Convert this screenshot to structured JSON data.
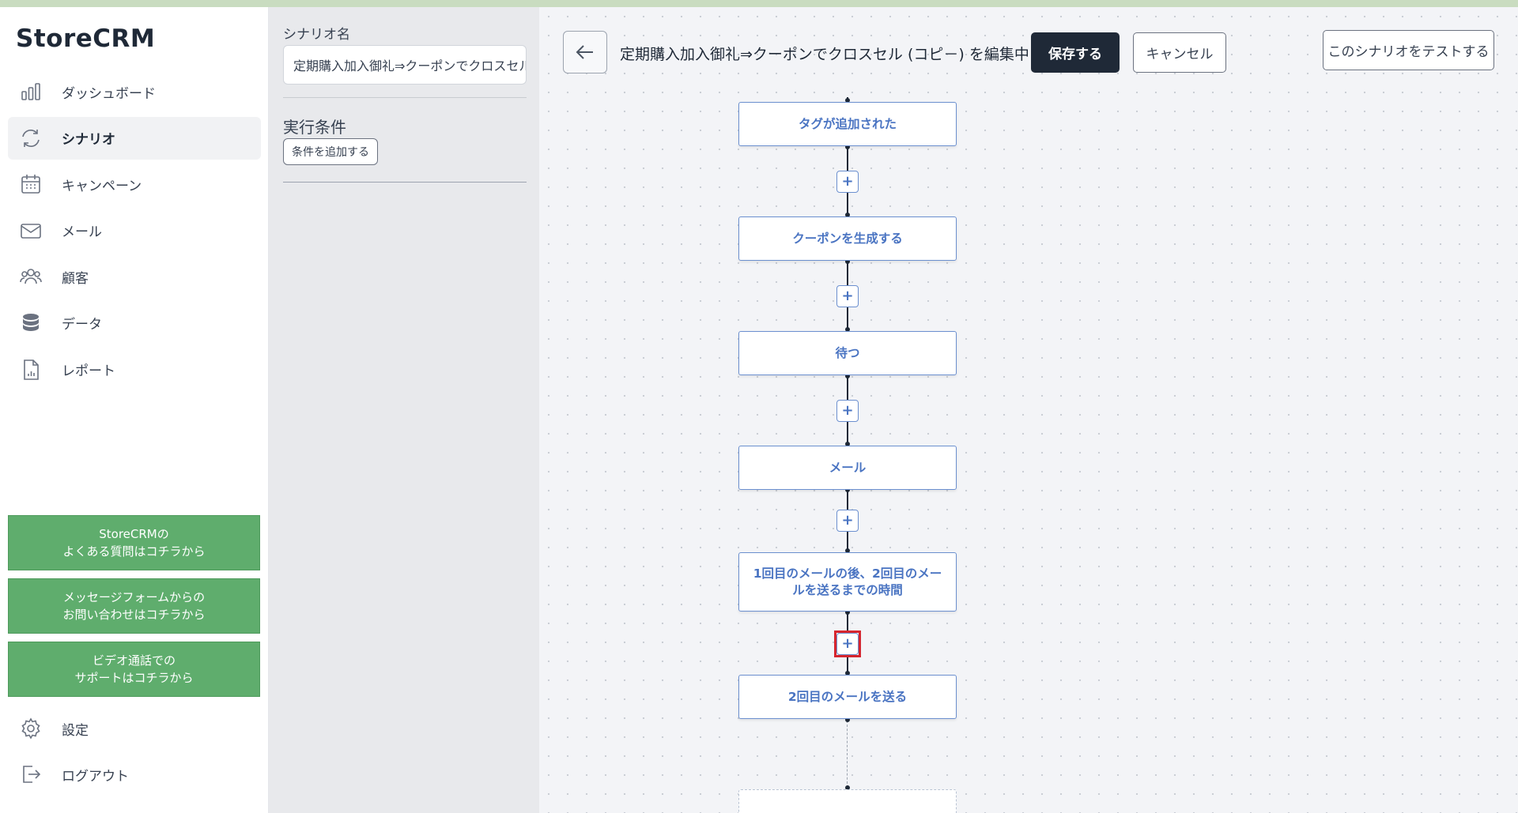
{
  "app": {
    "logo": "StoreCRM"
  },
  "sidebar": {
    "items": [
      {
        "label": "ダッシュボード",
        "icon": "bar-chart-icon"
      },
      {
        "label": "シナリオ",
        "icon": "refresh-icon",
        "active": true
      },
      {
        "label": "キャンペーン",
        "icon": "calendar-icon"
      },
      {
        "label": "メール",
        "icon": "mail-icon"
      },
      {
        "label": "顧客",
        "icon": "users-icon"
      },
      {
        "label": "データ",
        "icon": "database-icon"
      },
      {
        "label": "レポート",
        "icon": "report-icon"
      }
    ],
    "help_buttons": [
      {
        "line1": "StoreCRMの",
        "line2": "よくある質問はコチラから"
      },
      {
        "line1": "メッセージフォームからの",
        "line2": "お問い合わせはコチラから"
      },
      {
        "line1": "ビデオ通話での",
        "line2": "サポートはコチラから"
      }
    ],
    "bottom_items": [
      {
        "label": "設定",
        "icon": "gear-icon"
      },
      {
        "label": "ログアウト",
        "icon": "logout-icon"
      }
    ],
    "help_color": "#5fad6d"
  },
  "panel": {
    "name_label": "シナリオ名",
    "name_value": "定期購入加入御礼⇒クーポンでクロスセル (コピー)",
    "conditions_label": "実行条件",
    "add_condition_button": "条件を追加する"
  },
  "header": {
    "title": "定期購入加入御礼⇒クーポンでクロスセル (コピ－) を編集中",
    "save_button": "保存する",
    "cancel_button": "キャンセル",
    "test_button": "このシナリオをテストする"
  },
  "flow": {
    "nodes": [
      {
        "label": "タグが追加された"
      },
      {
        "label": "クーポンを生成する"
      },
      {
        "label": "待つ"
      },
      {
        "label": "メール"
      },
      {
        "label": "1回目のメールの後、2回目のメールを送るまでの時間"
      },
      {
        "label": "2回目のメールを送る"
      }
    ],
    "add_step_symbol": "+",
    "highlight_color": "#d6262f"
  }
}
